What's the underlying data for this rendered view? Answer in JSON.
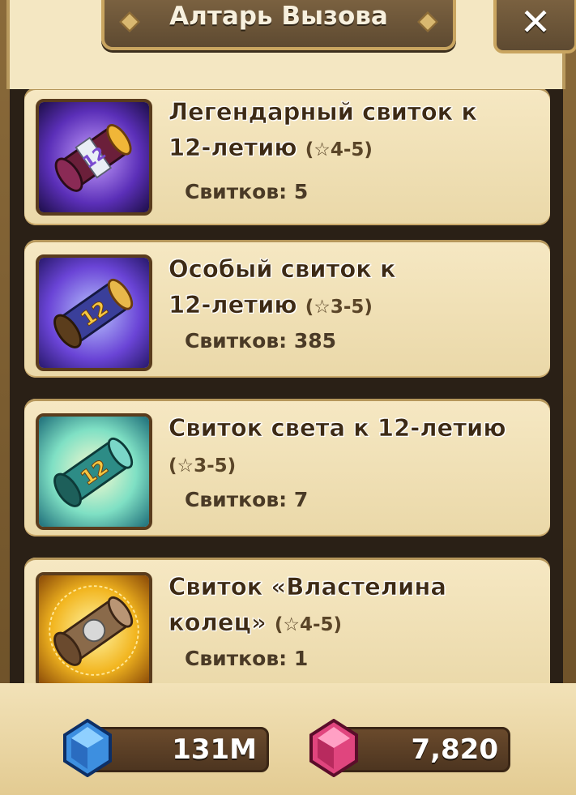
{
  "header": {
    "title": "Алтарь Вызова",
    "close_label": "✕"
  },
  "scrolls": [
    {
      "name": "Легендарный свиток к 12-летию",
      "name_line1": "Легендарный свиток к",
      "name_line2": "12-летию",
      "stars": "(☆4-5)",
      "count": "Свитков: 5"
    },
    {
      "name": "Особый свиток к 12-летию",
      "name_line1": "Особый свиток к",
      "name_line2": "12-летию",
      "stars": "(☆3-5)",
      "count": "Свитков: 385"
    },
    {
      "name": "Свиток света к 12-летию",
      "name_line1": "Свиток света к 12-летию",
      "name_line2": "",
      "stars": "(☆3-5)",
      "count": "Свитков: 7"
    },
    {
      "name": "Свиток «Властелина колец»",
      "name_line1": "Свиток «Властелина",
      "name_line2": "колец»",
      "stars": "(☆4-5)",
      "count": "Свитков: 1"
    }
  ],
  "currencies": {
    "crystals": {
      "icon": "blue-crystal-icon",
      "value": "131M"
    },
    "gems": {
      "icon": "pink-crystal-icon",
      "value": "7,820"
    }
  }
}
